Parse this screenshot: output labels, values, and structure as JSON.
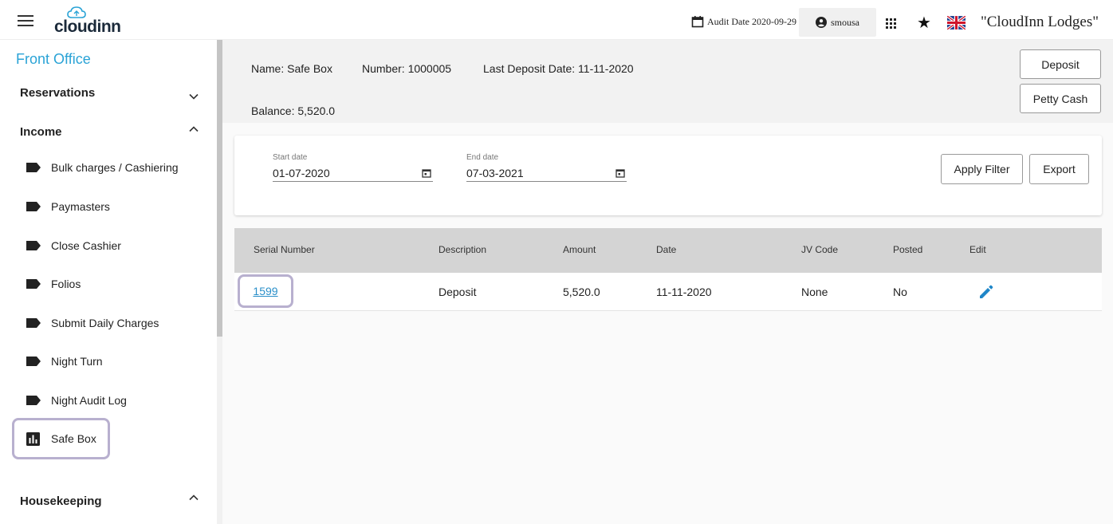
{
  "topbar": {
    "logo_text": "cloudinn",
    "audit_date": "Audit Date 2020-09-29",
    "username": "smousa",
    "hotel_name": "\"CloudInn Lodges\""
  },
  "sidebar": {
    "title": "Front Office",
    "sections": [
      {
        "label": "Reservations",
        "expanded": false
      },
      {
        "label": "Income",
        "expanded": true
      },
      {
        "label": "Housekeeping",
        "expanded": true
      }
    ],
    "items": [
      {
        "label": "Bulk charges / Cashiering"
      },
      {
        "label": "Paymasters"
      },
      {
        "label": "Close Cashier"
      },
      {
        "label": "Folios"
      },
      {
        "label": "Submit Daily Charges"
      },
      {
        "label": "Night Turn"
      },
      {
        "label": "Night Audit Log"
      },
      {
        "label": "Safe Box",
        "active": true
      }
    ]
  },
  "info": {
    "name": "Name: Safe Box",
    "number": "Number: 1000005",
    "last_deposit": "Last Deposit Date: 11-11-2020",
    "balance": "Balance: 5,520.0",
    "deposit_label": "Deposit",
    "petty_cash_label": "Petty Cash"
  },
  "filter": {
    "start_label": "Start date",
    "start_value": "01-07-2020",
    "end_label": "End date",
    "end_value": "07-03-2021",
    "apply_label": "Apply Filter",
    "export_label": "Export"
  },
  "table": {
    "headers": [
      "Serial Number",
      "Description",
      "Amount",
      "Date",
      "JV Code",
      "Posted",
      "Edit"
    ],
    "rows": [
      {
        "serial": "1599",
        "description": "Deposit",
        "amount": "5,520.0",
        "date": "11-11-2020",
        "jv_code": "None",
        "posted": "No"
      }
    ]
  },
  "colors": {
    "accent": "#2aa3d6",
    "link": "#2a8fc9",
    "highlight_border": "#b8b0cf",
    "edit_icon": "#1f86c8"
  }
}
